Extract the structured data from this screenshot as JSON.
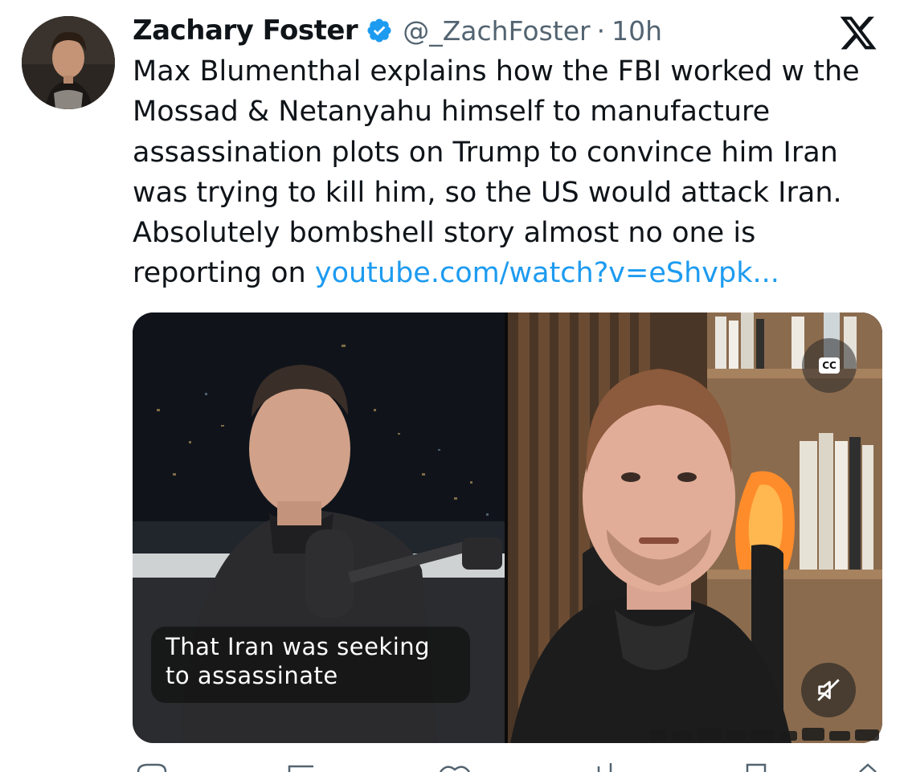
{
  "post": {
    "author_name": "Zachary Foster",
    "handle": "@_ZachFoster",
    "separator": "·",
    "time": "10h",
    "text": "Max Blumenthal explains how the FBI worked w the Mossad & Netanyahu himself to manufacture assassination plots on Trump to convince him Iran was trying to kill him, so the US would attack Iran. Absolutely bombshell story almost no one is reporting on ",
    "link_text": "youtube.com/watch?v=eShvpk..."
  },
  "video": {
    "caption": "That Iran was seeking to assassinate",
    "cc_label": "CC"
  },
  "colors": {
    "link": "#1d9bf0",
    "text": "#0f1419",
    "secondary": "#536471",
    "verified": "#1d9bf0"
  },
  "icons": {
    "verified": "verified-badge-icon",
    "platform": "x-logo-icon",
    "captions": "closed-captions-icon",
    "mute": "speaker-muted-icon"
  }
}
